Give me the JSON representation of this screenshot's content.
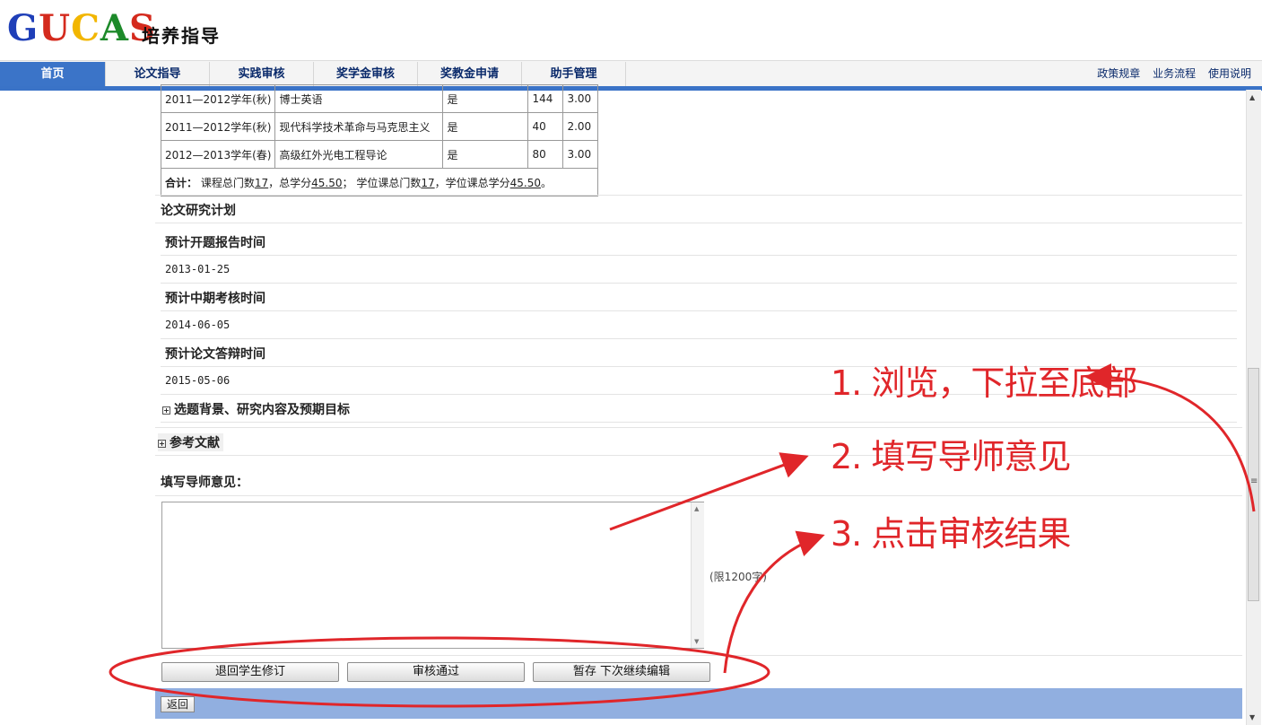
{
  "logo": {
    "letters": [
      "G",
      "U",
      "C",
      "A",
      "S"
    ],
    "subtitle": "培养指导"
  },
  "nav": {
    "items": [
      "首页",
      "论文指导",
      "实践审核",
      "奖学金审核",
      "奖教金申请",
      "助手管理"
    ],
    "right": [
      "政策规章",
      "业务流程",
      "使用说明"
    ],
    "active_color": "#3b74c8"
  },
  "courses": {
    "rows": [
      {
        "term": "2011—2012学年(秋)",
        "name": "博士英语",
        "degree": "是",
        "hours": "144",
        "credit": "3.00"
      },
      {
        "term": "2011—2012学年(秋)",
        "name": "现代科学技术革命与马克思主义",
        "degree": "是",
        "hours": "40",
        "credit": "2.00"
      },
      {
        "term": "2012—2013学年(春)",
        "name": "高级红外光电工程导论",
        "degree": "是",
        "hours": "80",
        "credit": "3.00"
      }
    ],
    "total_label": "合计：",
    "total_p1": "课程总门数",
    "total_v1": "17",
    "total_p2": "，总学分",
    "total_v2": "45.50",
    "total_p3": "；  学位课总门数",
    "total_v3": "17",
    "total_p4": "，学位课总学分",
    "total_v4": "45.50",
    "total_p5": "。"
  },
  "plan": {
    "title": "论文研究计划",
    "opening_label": "预计开题报告时间",
    "opening_value": "2013-01-25",
    "midterm_label": "预计中期考核时间",
    "midterm_value": "2014-06-05",
    "defense_label": "预计论文答辩时间",
    "defense_value": "2015-05-06",
    "background_label": "选题背景、研究内容及预期目标",
    "references_label": "参考文献"
  },
  "opinion": {
    "label": "填写导师意见：",
    "value": "",
    "limit": "(限1200字)"
  },
  "buttons": {
    "return_revise": "退回学生修订",
    "approve": "审核通过",
    "save_draft": "暂存  下次继续编辑",
    "back": "返回"
  },
  "annotations": {
    "step1": "1. 浏览，下拉至底部",
    "step2": "2. 填写导师意见",
    "step3": "3. 点击审核结果",
    "color": "#e0262a"
  }
}
